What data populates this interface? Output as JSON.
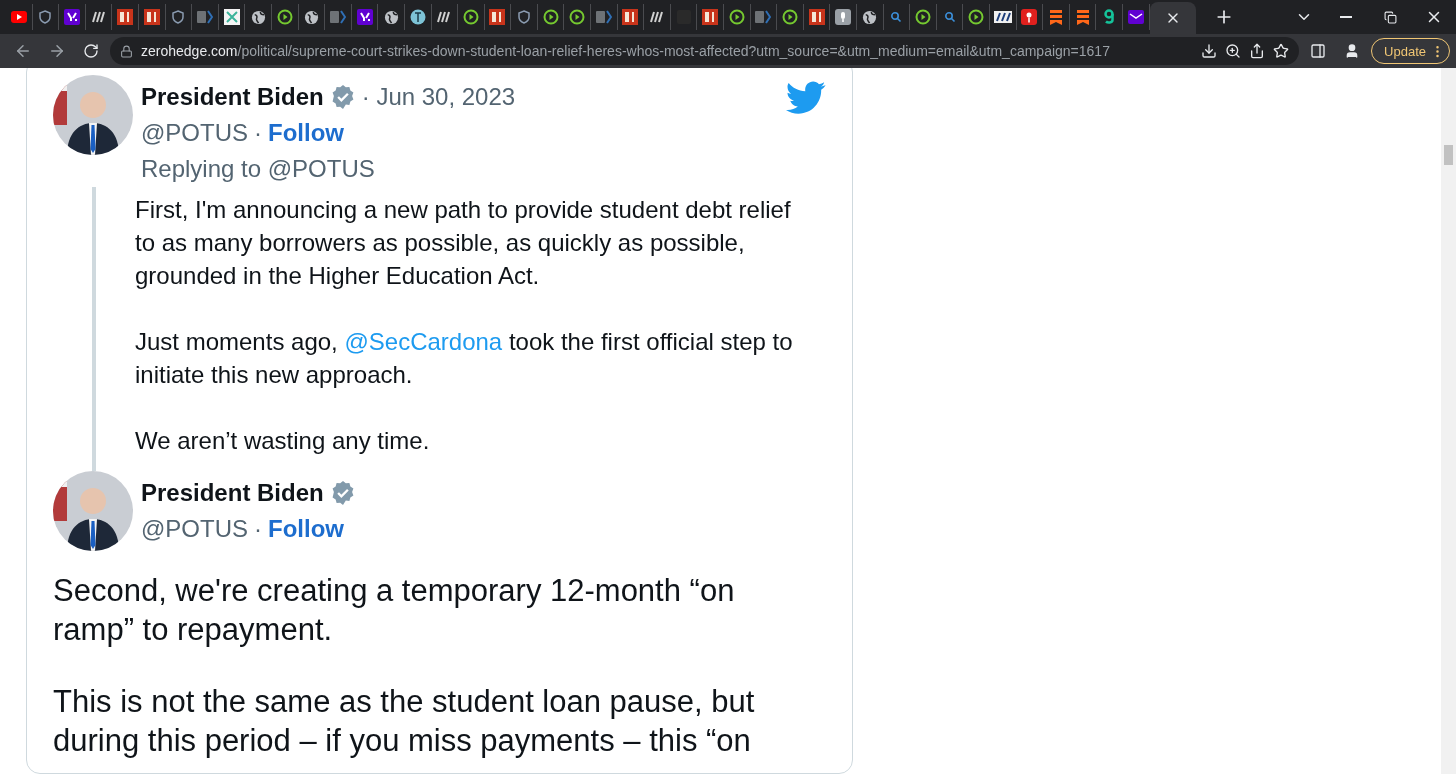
{
  "browser": {
    "tabs": [
      {
        "kind": "youtube",
        "selected": false
      },
      {
        "kind": "shield",
        "selected": false
      },
      {
        "kind": "yahoo",
        "selected": false
      },
      {
        "kind": "stripes",
        "selected": false
      },
      {
        "kind": "bi",
        "selected": false
      },
      {
        "kind": "bi",
        "selected": false
      },
      {
        "kind": "shield",
        "selected": false
      },
      {
        "kind": "chevron",
        "selected": false
      },
      {
        "kind": "grid",
        "selected": false
      },
      {
        "kind": "globe",
        "selected": false
      },
      {
        "kind": "play",
        "selected": false
      },
      {
        "kind": "globe",
        "selected": false
      },
      {
        "kind": "chevron",
        "selected": false
      },
      {
        "kind": "yahoo",
        "selected": false
      },
      {
        "kind": "globe",
        "selected": false
      },
      {
        "kind": "teal",
        "selected": false
      },
      {
        "kind": "stripes",
        "selected": false
      },
      {
        "kind": "play",
        "selected": false
      },
      {
        "kind": "bi",
        "selected": false
      },
      {
        "kind": "shield",
        "selected": false
      },
      {
        "kind": "play",
        "selected": false
      },
      {
        "kind": "play",
        "selected": false
      },
      {
        "kind": "chevron",
        "selected": false
      },
      {
        "kind": "bi",
        "selected": false
      },
      {
        "kind": "stripes",
        "selected": false
      },
      {
        "kind": "dark",
        "selected": false
      },
      {
        "kind": "bi",
        "selected": false
      },
      {
        "kind": "play",
        "selected": false
      },
      {
        "kind": "chevron",
        "selected": false
      },
      {
        "kind": "play",
        "selected": false
      },
      {
        "kind": "bi",
        "selected": false
      },
      {
        "kind": "mic",
        "selected": false
      },
      {
        "kind": "globe",
        "selected": false
      },
      {
        "kind": "search",
        "selected": false
      },
      {
        "kind": "play",
        "selected": false
      },
      {
        "kind": "search",
        "selected": false
      },
      {
        "kind": "play",
        "selected": false
      },
      {
        "kind": "news",
        "selected": false
      },
      {
        "kind": "pin",
        "selected": false
      },
      {
        "kind": "bookmark",
        "selected": false
      },
      {
        "kind": "bookmark",
        "selected": false
      },
      {
        "kind": "hook",
        "selected": false
      },
      {
        "kind": "mail",
        "selected": false
      },
      {
        "kind": "blank",
        "selected": true
      }
    ],
    "address": {
      "host": "zerohedge.com",
      "path": "/political/supreme-court-strikes-down-student-loan-relief-heres-whos-most-affected?utm_source=&utm_medium=email&utm_campaign=1617"
    },
    "update_button": "Update"
  },
  "tweets": [
    {
      "kind": "reply",
      "name": "President Biden",
      "verified": true,
      "date": "· Jun 30, 2023",
      "handle": "@POTUS",
      "separator": "·",
      "follow": "Follow",
      "replying_to": "Replying to @POTUS",
      "paragraphs": [
        [
          {
            "text": "First, I'm announcing a new path to provide student debt relief to as many borrowers as possible, as quickly as possible, grounded in the Higher Education Act."
          }
        ],
        [
          {
            "text": "Just moments ago, "
          },
          {
            "link": "@SecCardona"
          },
          {
            "text": " took the first official step to initiate this new approach."
          }
        ],
        [
          {
            "text": "We aren’t wasting any time."
          }
        ]
      ]
    },
    {
      "kind": "main",
      "name": "President Biden",
      "verified": true,
      "handle": "@POTUS",
      "separator": "·",
      "follow": "Follow",
      "paragraphs": [
        [
          {
            "text": "Second, we're creating a temporary 12-month “on ramp” to repayment."
          }
        ],
        [
          {
            "text": "This is not the same as the student loan pause, but during this period – if you miss payments – this “on"
          }
        ]
      ]
    }
  ]
}
